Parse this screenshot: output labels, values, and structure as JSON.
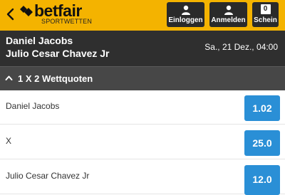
{
  "header": {
    "logo_text": "betfair",
    "logo_sub": "SPORTWETTEN",
    "login_label": "Einloggen",
    "register_label": "Anmelden",
    "slip_label": "Schein",
    "slip_count": "0",
    "colors": {
      "bar": "#f4b300",
      "button": "#2a2a2a"
    }
  },
  "event": {
    "team1": "Daniel Jacobs",
    "team2": "Julio Cesar Chavez Jr",
    "datetime": "Sa., 21 Dez., 04:00"
  },
  "market": {
    "title": "1 X 2 Wettquoten"
  },
  "runners": [
    {
      "name": "Daniel Jacobs",
      "odds": "1.02"
    },
    {
      "name": "X",
      "odds": "25.0"
    },
    {
      "name": "Julio Cesar Chavez Jr",
      "odds": "12.0"
    }
  ],
  "icons": {
    "back": "chevron-left-icon",
    "logo": "betfair-logo-mark",
    "login": "user-icon",
    "register": "user-icon",
    "market_toggle": "chevron-up-icon"
  },
  "accent": "#2a8fd6"
}
